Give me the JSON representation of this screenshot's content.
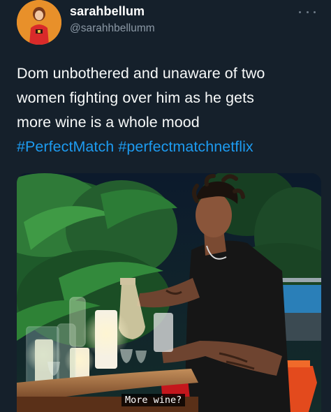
{
  "author": {
    "display_name": "sarahbellum",
    "handle": "@sarahhbellumm",
    "avatar_icon": "avatar-illustration"
  },
  "menu": {
    "more_icon": "more-horizontal-icon"
  },
  "tweet": {
    "line1": "Dom unbothered and unaware of two",
    "line2": "women fighting over him as he gets",
    "line3": "more wine is a whole mood",
    "hashtag1": "#PerfectMatch",
    "hashtag2": "#perfectmatchnetflix"
  },
  "media": {
    "caption": "More wine?"
  },
  "colors": {
    "background": "#15202b",
    "text": "#f7f9f9",
    "secondary_text": "#8b98a5",
    "link": "#1d9bf0"
  }
}
